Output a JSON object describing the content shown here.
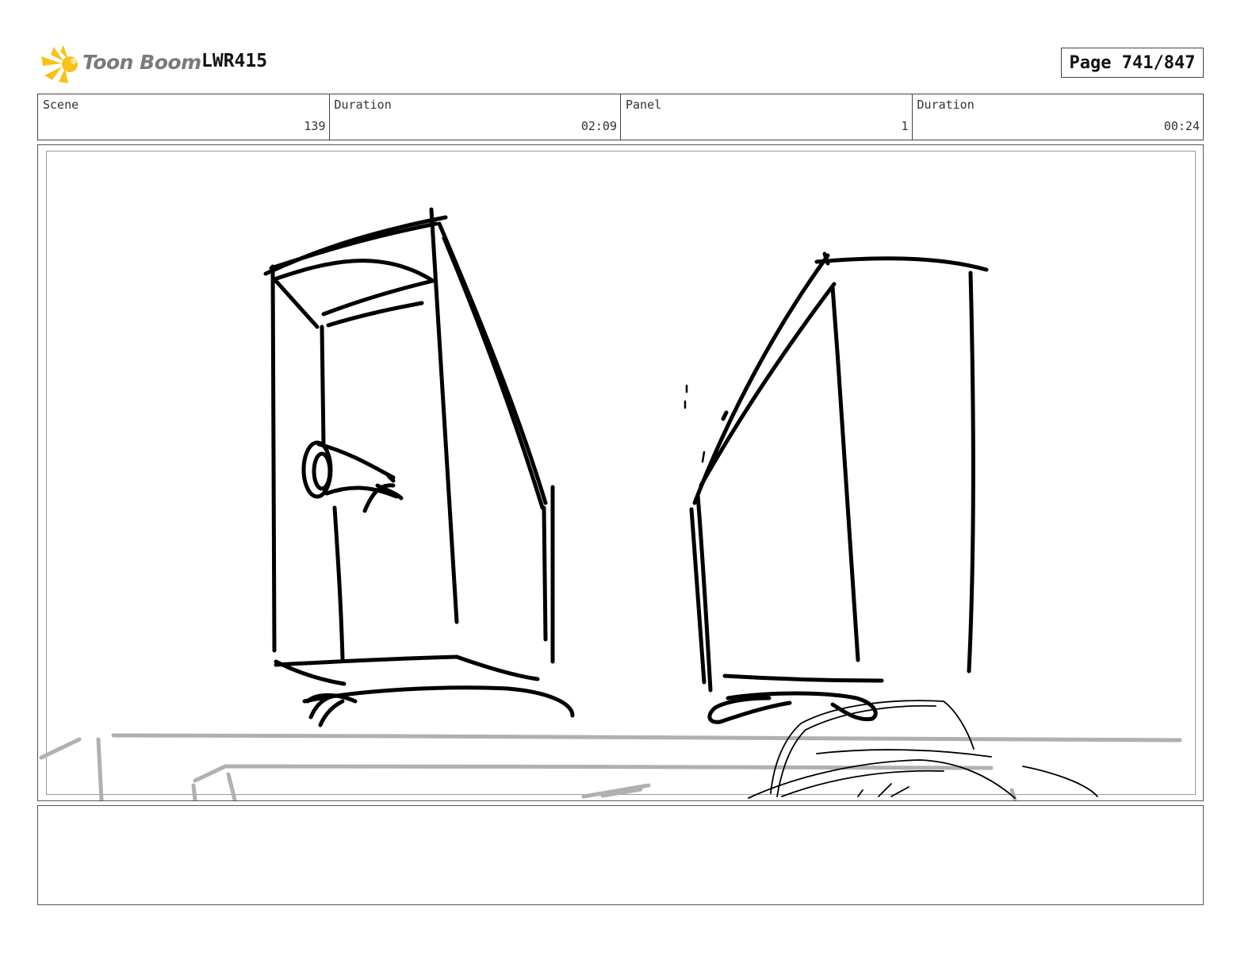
{
  "header": {
    "brand_name": "Toon Boom",
    "project_code": "LWR415",
    "page_label": "Page 741/847"
  },
  "info": [
    {
      "label": "Scene",
      "value": "139"
    },
    {
      "label": "Duration",
      "value": "02:09"
    },
    {
      "label": "Panel",
      "value": "1"
    },
    {
      "label": "Duration",
      "value": "00:24"
    }
  ],
  "panel": {
    "description": "",
    "sketch_subject": "two-tall-boxes-on-table"
  },
  "notes": {
    "text": ""
  },
  "colors": {
    "logo_yellow": "#f7c21b",
    "logo_text": "#7a7a7a",
    "ink": "#000000",
    "guide_gray": "#b0b0b0",
    "frame_border": "#555555"
  }
}
